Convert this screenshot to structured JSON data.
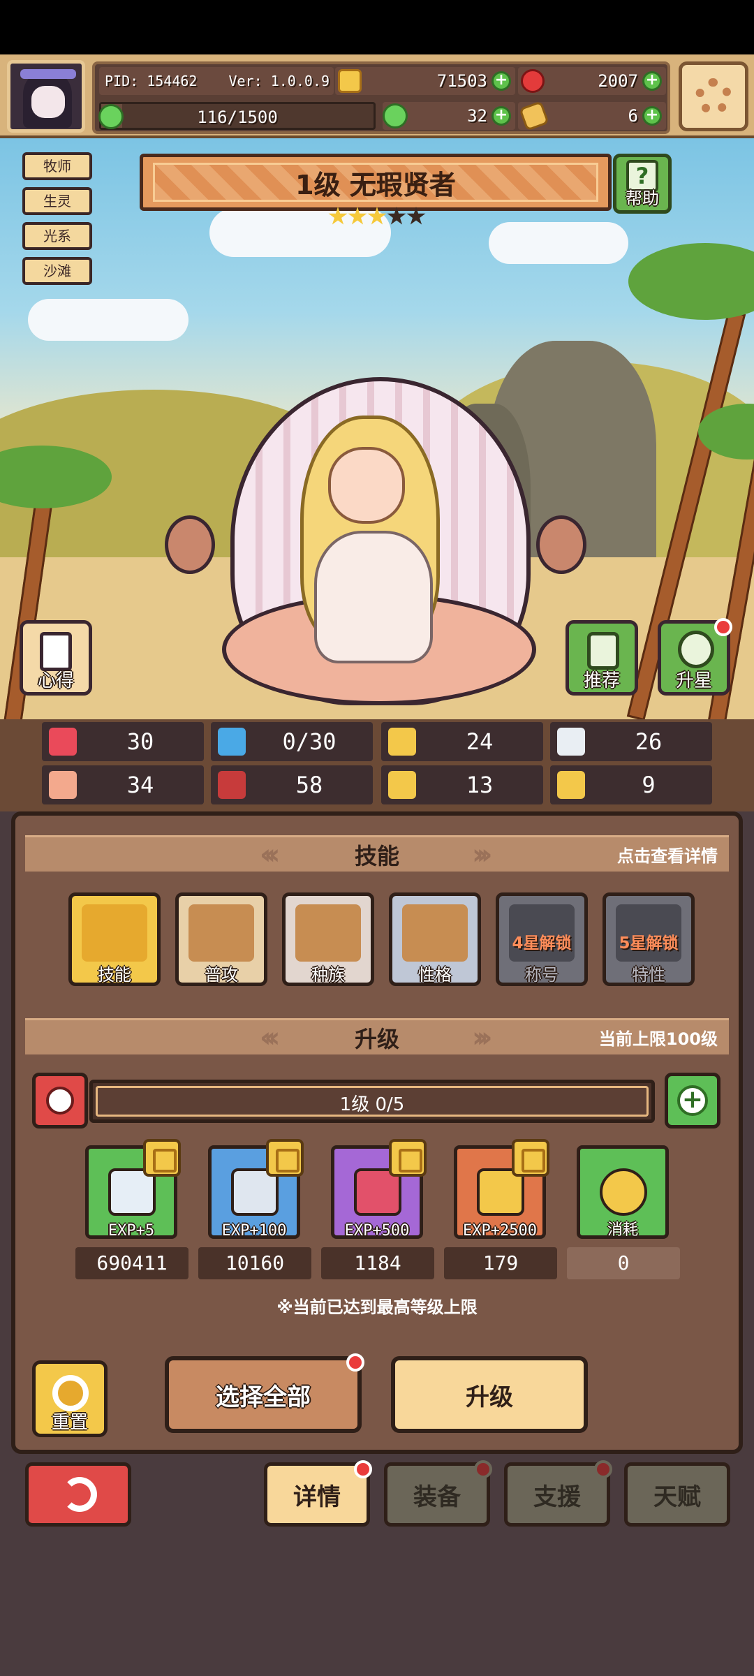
{
  "player": {
    "pid": "PID: 154462",
    "version": "Ver: 1.0.0.9",
    "energy": "116/1500",
    "energy_fraction": 0.077
  },
  "resources": {
    "gold": "71503",
    "gems": "2007",
    "clover": "32",
    "bottle": "6"
  },
  "tags": [
    "牧师",
    "生灵",
    "光系",
    "沙滩"
  ],
  "hero": {
    "title": "1级  无瑕贤者",
    "stars_filled": 3,
    "stars_total": 5,
    "help_label": "帮助",
    "insight_label": "心得",
    "recommend_label": "推荐",
    "starup_label": "升星"
  },
  "stats": [
    {
      "icon": "heart-icon",
      "value": "30",
      "color": "#ea4a5a"
    },
    {
      "icon": "water-drop-icon",
      "value": "0/30",
      "color": "#4aa9e6"
    },
    {
      "icon": "shield-icon",
      "value": "24",
      "color": "#f3c84a"
    },
    {
      "icon": "wing-icon",
      "value": "26",
      "color": "#e9eef3"
    },
    {
      "icon": "fist-icon",
      "value": "34",
      "color": "#f3a98d"
    },
    {
      "icon": "book-icon",
      "value": "58",
      "color": "#c73b3b"
    },
    {
      "icon": "boot-icon",
      "value": "13",
      "color": "#f3c84a"
    },
    {
      "icon": "horseshoe-icon",
      "value": "9",
      "color": "#f3c84a"
    }
  ],
  "skills_section": {
    "title": "技能",
    "note": "点击查看详情",
    "items": [
      {
        "label": "技能",
        "lock": "",
        "bg": "#f3c84a",
        "inner": "#e6a92e"
      },
      {
        "label": "普攻",
        "lock": "",
        "bg": "#e8d0a8",
        "inner": "#c78d52"
      },
      {
        "label": "种族",
        "lock": "",
        "bg": "#e2d6cf",
        "inner": "#c78d52"
      },
      {
        "label": "性格",
        "lock": "",
        "bg": "#bfc7d6",
        "inner": "#c78d52"
      },
      {
        "label": "称号",
        "lock": "4星解锁",
        "bg": "#6f6f78",
        "inner": "#4a4a52"
      },
      {
        "label": "特性",
        "lock": "5星解锁",
        "bg": "#6f6f78",
        "inner": "#4a4a52"
      }
    ]
  },
  "upgrade_section": {
    "title": "升级",
    "note": "当前上限100级",
    "level_text": "1级  0/5",
    "items": [
      {
        "exp": "EXP+5",
        "count": "690411",
        "bg": "#5ebf57",
        "gem": "#e6eef6"
      },
      {
        "exp": "EXP+100",
        "count": "10160",
        "bg": "#5a9fe0",
        "gem": "#dfe6ef"
      },
      {
        "exp": "EXP+500",
        "count": "1184",
        "bg": "#a568d6",
        "gem": "#e2516a"
      },
      {
        "exp": "EXP+2500",
        "count": "179",
        "bg": "#e0764a",
        "gem": "#f3c84a"
      },
      {
        "exp": "消耗",
        "count": "0",
        "bg": "#5ebf57",
        "gem": "#f3c84a"
      }
    ],
    "max_note": "※当前已达到最高等级上限"
  },
  "actions": {
    "reset": "重置",
    "select_all": "选择全部",
    "upgrade": "升级"
  },
  "tabs": {
    "details": "详情",
    "equipment": "装备",
    "support": "支援",
    "talent": "天赋"
  }
}
